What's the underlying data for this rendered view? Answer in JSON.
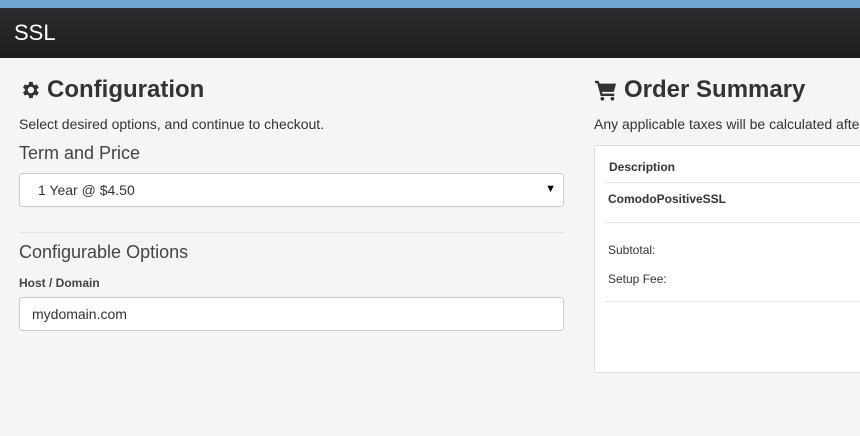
{
  "header": {
    "title": "SSL"
  },
  "configuration": {
    "title": "Configuration",
    "icon": "gear-icon",
    "subtitle": "Select desired options, and continue to checkout.",
    "term_title": "Term and Price",
    "term_selected": "1 Year @ $4.50",
    "options_title": "Configurable Options",
    "host_label": "Host / Domain",
    "host_value": "mydomain.com"
  },
  "summary": {
    "title": "Order Summary",
    "icon": "cart-icon",
    "subtitle": "Any applicable taxes will be calculated afte",
    "description_header": "Description",
    "product": "ComodoPositiveSSL",
    "subtotal_label": "Subtotal:",
    "setup_fee_label": "Setup Fee:"
  },
  "colors": {
    "accent_strip": "#6fa9d3",
    "header_bg": "#252525",
    "page_bg": "#f5f5f5"
  }
}
